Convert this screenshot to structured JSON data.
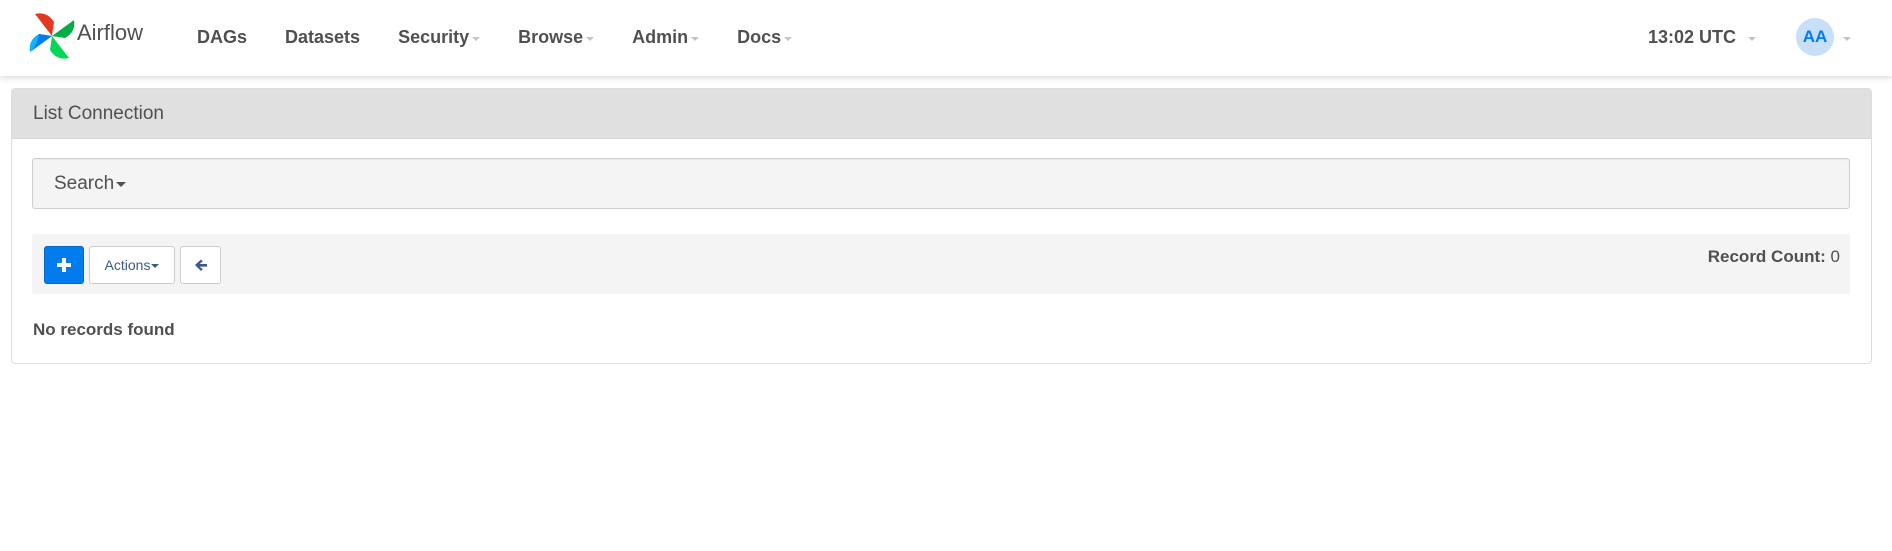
{
  "app": {
    "name": "Airflow"
  },
  "navbar": {
    "items": [
      {
        "label": "DAGs",
        "has_dropdown": false
      },
      {
        "label": "Datasets",
        "has_dropdown": false
      },
      {
        "label": "Security",
        "has_dropdown": true
      },
      {
        "label": "Browse",
        "has_dropdown": true
      },
      {
        "label": "Admin",
        "has_dropdown": true
      },
      {
        "label": "Docs",
        "has_dropdown": true
      }
    ],
    "clock": "13:02 UTC",
    "user_initials": "AA"
  },
  "panel": {
    "title": "List Connection",
    "search_label": "Search",
    "toolbar": {
      "add_icon": "plus-icon",
      "actions_label": "Actions",
      "back_icon": "arrow-left-icon"
    },
    "record_count_label": "Record Count:",
    "record_count_value": "0",
    "empty_message": "No records found"
  },
  "colors": {
    "primary": "#017cee",
    "text": "#51504f",
    "avatar_bg": "#c7dff8",
    "panel_heading_bg": "#e0e0e0",
    "well_bg": "#f4f4f4",
    "link_dark": "#3c5b84"
  }
}
